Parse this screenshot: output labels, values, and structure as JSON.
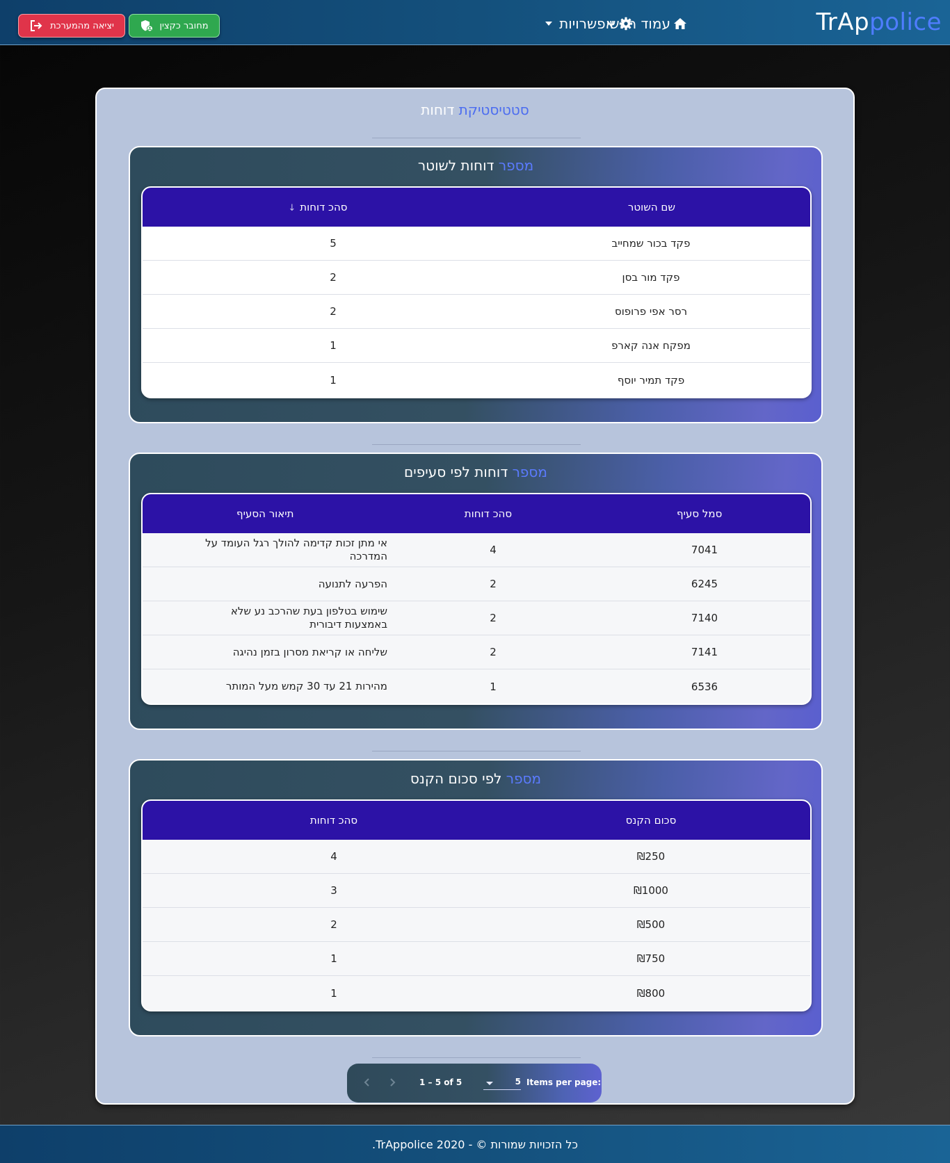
{
  "navbar": {
    "brand_main": "TrAp",
    "brand_accent": "police",
    "home_label": "עמוד ראשי",
    "options_label": "אפשרויות",
    "connected_label": "מחובר כקצין",
    "logout_label": "יציאה מהמערכת"
  },
  "page": {
    "title_highlight": "סטטיסטיקת",
    "title_rest": "דוחות"
  },
  "officers": {
    "title_highlight": "מספר",
    "title_rest": "דוחות לשוטר",
    "headers": {
      "name": "שם השוטר",
      "total": "סהכ דוחות"
    },
    "rows": [
      {
        "name": "פקד בכור שמחייב",
        "total": "5"
      },
      {
        "name": "פקד מור בסן",
        "total": "2"
      },
      {
        "name": "רסר אפי פרופוס",
        "total": "2"
      },
      {
        "name": "מפקח אנה קארפ",
        "total": "1"
      },
      {
        "name": "פקד תמיר יוסף",
        "total": "1"
      }
    ]
  },
  "sections": {
    "title_highlight": "מספר",
    "title_rest": "דוחות לפי סעיפים",
    "headers": {
      "code": "סמל סעיף",
      "total": "סהכ דוחות",
      "desc": "תיאור הסעיף"
    },
    "rows": [
      {
        "code": "7041",
        "total": "4",
        "desc": "אי מתן זכות קדימה להולך רגל העומד על המדרכה"
      },
      {
        "code": "6245",
        "total": "2",
        "desc": "הפרעה לתנועה"
      },
      {
        "code": "7140",
        "total": "2",
        "desc": "שימוש בטלפון בעת שהרכב נע שלא באמצעות דיבורית"
      },
      {
        "code": "7141",
        "total": "2",
        "desc": "שליחה או קריאת מסרון בזמן נהיגה"
      },
      {
        "code": "6536",
        "total": "1",
        "desc": "מהירות 21 עד 30 קמש מעל המותר"
      }
    ]
  },
  "fines": {
    "title_highlight": "מספר",
    "title_rest": "לפי סכום הקנס",
    "headers": {
      "amount": "סכום הקנס",
      "total": "סהכ דוחות"
    },
    "rows": [
      {
        "amount": "₪250",
        "total": "4"
      },
      {
        "amount": "₪1000",
        "total": "3"
      },
      {
        "amount": "₪500",
        "total": "2"
      },
      {
        "amount": "₪750",
        "total": "1"
      },
      {
        "amount": "₪800",
        "total": "1"
      }
    ]
  },
  "paginator": {
    "items_per_page_label": "Items per page:",
    "page_size": "5",
    "range": "1 – 5 of 5"
  },
  "footer": {
    "text": "כל הזכויות שמורות © - TrAppolice 2020."
  },
  "colors": {
    "header_bar": "#14507c",
    "table_head": "#2c12a6",
    "accent_blue": "#4b6cf0",
    "connected_green": "#2fa84f",
    "logout_red": "#e0344a"
  }
}
